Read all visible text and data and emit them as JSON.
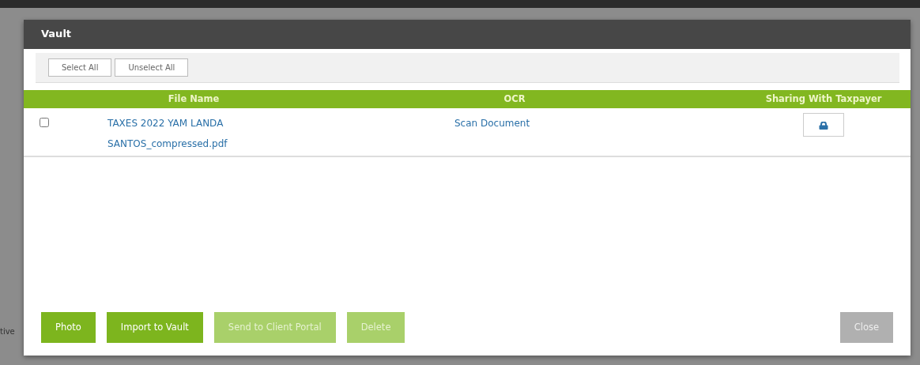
{
  "background_text": "tive",
  "window": {
    "title": "Vault"
  },
  "toolbar": {
    "buttons": [
      "Select All",
      "Unselect All"
    ]
  },
  "table": {
    "columns": [
      "File Name",
      "OCR",
      "Sharing With Taxpayer"
    ],
    "rows": [
      {
        "checked": false,
        "file_name": "TAXES 2022 YAM LANDA SANTOS_compressed.pdf",
        "ocr": "Scan Document",
        "shared": false
      }
    ]
  },
  "footer_buttons": [
    {
      "label": "Photo",
      "kind": "primary",
      "disabled": false
    },
    {
      "label": "Import to Vault",
      "kind": "primary",
      "disabled": false
    },
    {
      "label": "Send to Client Portal",
      "kind": "primary",
      "disabled": true
    },
    {
      "label": "Delete",
      "kind": "primary",
      "disabled": true
    },
    {
      "label": "Close",
      "kind": "secondary",
      "disabled": false
    }
  ]
}
